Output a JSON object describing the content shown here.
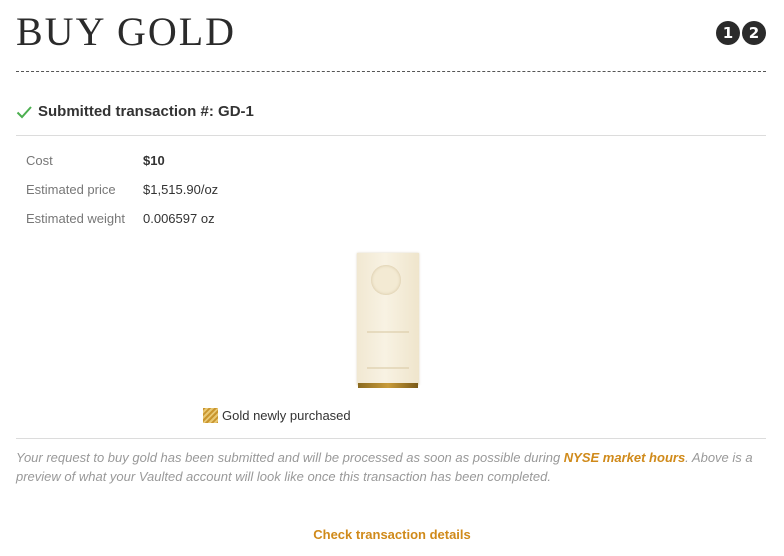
{
  "page_title": "BUY GOLD",
  "steps": [
    "1",
    "2"
  ],
  "status": {
    "text": "Submitted transaction #: GD-1",
    "color": "#4caf50"
  },
  "details": [
    {
      "label": "Cost",
      "value": "$10",
      "bold": true
    },
    {
      "label": "Estimated price",
      "value": "$1,515.90/oz",
      "bold": false
    },
    {
      "label": "Estimated weight",
      "value": "0.006597 oz",
      "bold": false
    }
  ],
  "legend": {
    "label": "Gold newly purchased"
  },
  "note": {
    "before": "Your request to buy gold has been submitted and will be processed as soon as possible during ",
    "link": "NYSE market hours",
    "after": ". Above is a preview of what your Vaulted account will look like once this transaction has been completed."
  },
  "cta": "Check transaction details",
  "colors": {
    "accent": "#d08a1a",
    "text": "#333333",
    "muted": "#999999"
  }
}
